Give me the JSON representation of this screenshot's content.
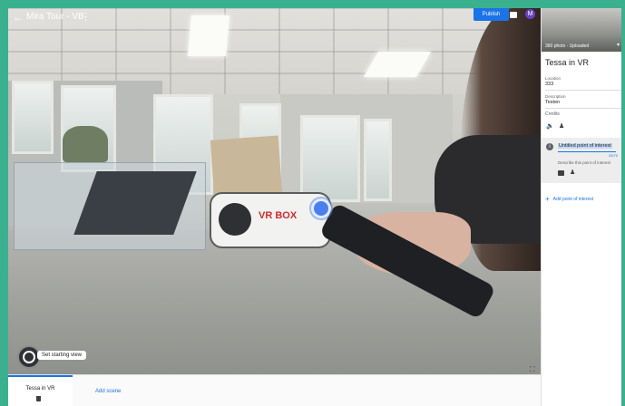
{
  "header": {
    "title": "Mira Tour - VB",
    "publish_label": "Publish",
    "avatar_letter": "M"
  },
  "viewer": {
    "headset_brand": "VR BOX",
    "start_view_label": "Set starting view"
  },
  "bottom": {
    "scene_name": "Tessa in VR",
    "add_scene_label": "Add scene"
  },
  "panel": {
    "thumb_label": "360 photo · Uploaded",
    "scene_title": "Tessa in VR",
    "location_label": "Location",
    "location_value": "333",
    "description_label": "Description",
    "description_value": "Testen",
    "credits_label": "Credits",
    "poi": {
      "title": "Untitled point of interest",
      "count": "25/70",
      "desc_placeholder": "Describe this point of interest"
    },
    "add_poi_label": "Add point of interest"
  },
  "colors": {
    "accent": "#1a73e8",
    "frame": "#3bb08f",
    "avatar": "#6a42c2"
  }
}
